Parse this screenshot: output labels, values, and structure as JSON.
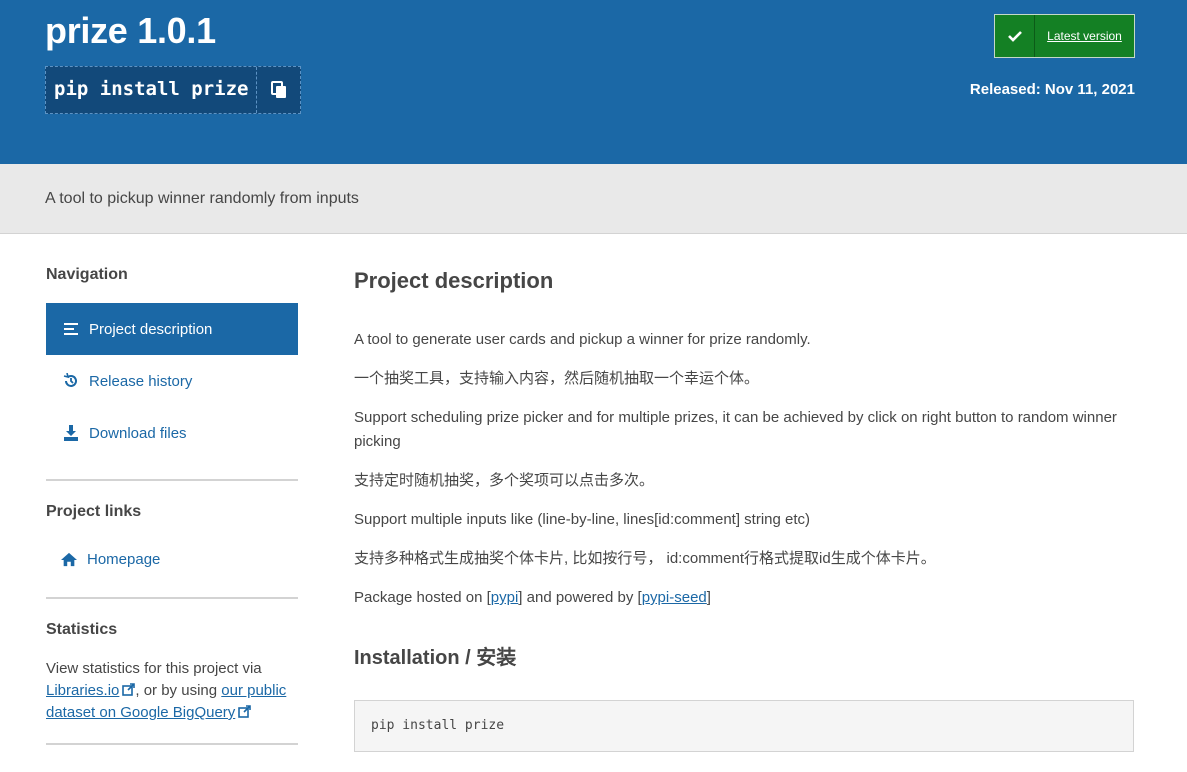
{
  "header": {
    "title": "prize 1.0.1",
    "pip_command": "pip install prize",
    "latest_label": "Latest version",
    "released": "Released: Nov 11, 2021"
  },
  "summary": "A tool to pickup winner randomly from inputs",
  "sidebar": {
    "navigation_heading": "Navigation",
    "nav_items": [
      {
        "label": "Project description",
        "icon": "list-icon",
        "active": true
      },
      {
        "label": "Release history",
        "icon": "history-icon"
      },
      {
        "label": "Download files",
        "icon": "download-icon"
      }
    ],
    "project_links_heading": "Project links",
    "homepage_label": "Homepage",
    "statistics_heading": "Statistics",
    "stats_prefix": "View statistics for this project via",
    "libraries_link": "Libraries.io",
    "stats_middle": ", or by using",
    "bigquery_link": "our public dataset on Google BigQuery"
  },
  "main": {
    "heading": "Project description",
    "p1": "A tool to generate user cards and pickup a winner for prize randomly.",
    "p2": "一个抽奖工具，支持输入内容，然后随机抽取一个幸运个体。",
    "p3": "Support scheduling prize picker and for multiple prizes, it can be achieved by click on right button to random winner picking",
    "p4": "支持定时随机抽奖，多个奖项可以点击多次。",
    "p5": "Support multiple inputs like (line-by-line, lines[id:comment] string etc)",
    "p6": "支持多种格式生成抽奖个体卡片, 比如按行号， id:comment行格式提取id生成个体卡片。",
    "hosted_prefix": "Package hosted on [",
    "pypi_link": "pypi",
    "hosted_middle": "] and powered by [",
    "seed_link": "pypi-seed",
    "hosted_suffix": "]",
    "install_heading": "Installation / 安装",
    "install_code": "pip install prize"
  },
  "colors": {
    "header_bg": "#1b68a6",
    "latest_green": "#148024",
    "summary_bg": "#e9e9e9"
  }
}
